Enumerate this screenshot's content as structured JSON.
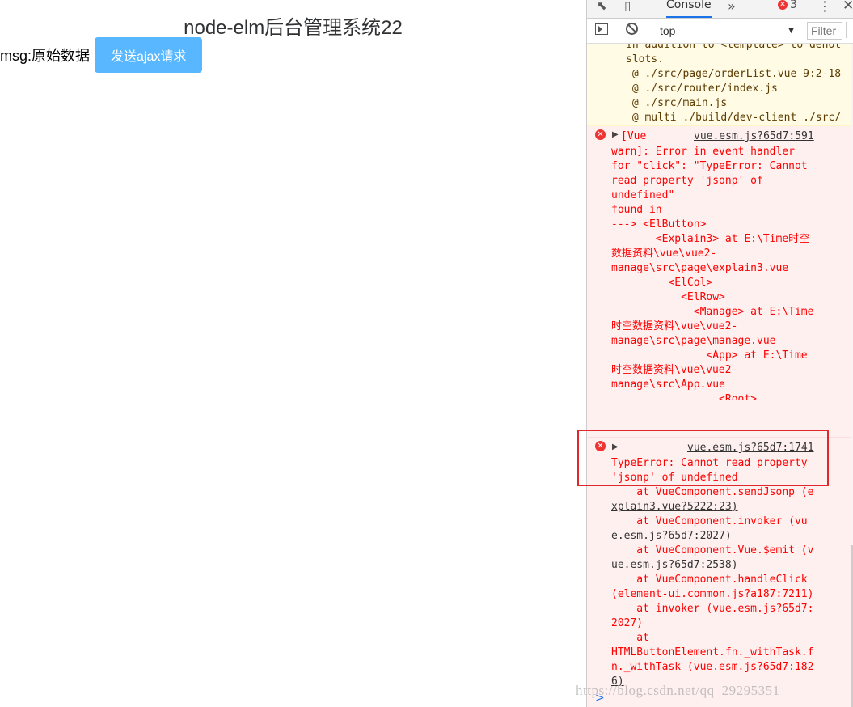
{
  "app": {
    "title": "node-elm后台管理系统22",
    "msg_label": "msg:原始数据",
    "ajax_button": "发送ajax请求"
  },
  "devtools": {
    "tab_console": "Console",
    "more_tabs": "»",
    "error_count": "3",
    "context": "top",
    "filter_placeholder": "Filter",
    "warn_lines": [
      "in addition to <template> to denot",
      "slots.",
      " @ ./src/page/orderList.vue 9:2-18",
      " @ ./src/router/index.js",
      " @ ./src/main.js",
      " @ multi ./build/dev-client ./src/"
    ],
    "error1": {
      "prefix": "[Vue",
      "source": "vue.esm.js?65d7:591",
      "lines": [
        "warn]: Error in event handler",
        "for \"click\": \"TypeError: Cannot",
        "read property 'jsonp' of",
        "undefined\"",
        "",
        "found in",
        "",
        "---> <ElButton>",
        "       <Explain3> at E:\\Time时空",
        "数据资料\\vue\\vue2-",
        "manage\\src\\page\\explain3.vue",
        "         <ElCol>",
        "           <ElRow>",
        "             <Manage> at E:\\Time",
        "时空数据资料\\vue\\vue2-",
        "manage\\src\\page\\manage.vue",
        "               <App> at E:\\Time",
        "时空数据资料\\vue\\vue2-",
        "manage\\src\\App.vue",
        "                 <Root>"
      ]
    },
    "error2": {
      "source": "vue.esm.js?65d7:1741",
      "lines": [
        "TypeError: Cannot read property",
        "'jsonp' of undefined",
        "    at VueComponent.sendJsonp (e",
        "xplain3.vue?5222:23)",
        "    at VueComponent.invoker (vu",
        "e.esm.js?65d7:2027)",
        "    at VueComponent.Vue.$emit (v",
        "ue.esm.js?65d7:2538)",
        "    at VueComponent.handleClick",
        "(element-ui.common.js?a187:7211)",
        "    at invoker (vue.esm.js?65d7:",
        "2027)",
        "    at",
        "HTMLButtonElement.fn._withTask.f",
        "n._withTask (vue.esm.js?65d7:182",
        "6)"
      ]
    },
    "prompt": ">",
    "watermark": "https://blog.csdn.net/qq_29295351"
  }
}
